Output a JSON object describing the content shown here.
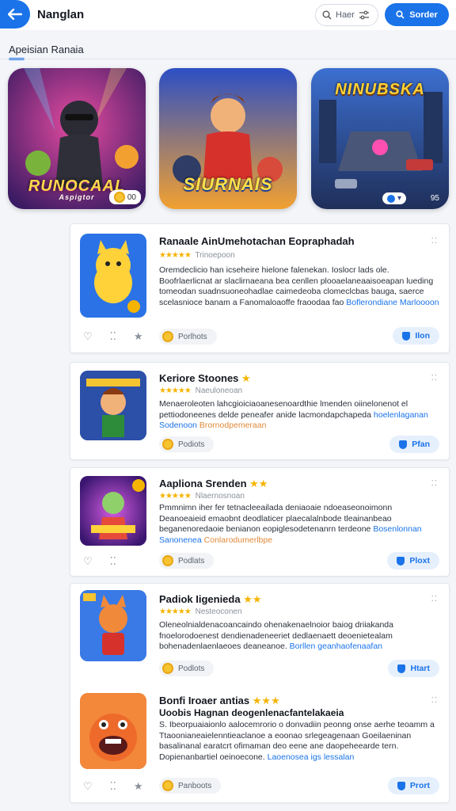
{
  "header": {
    "title": "Nanglan",
    "search_label": "Haer",
    "update_label": "Sorder"
  },
  "section": {
    "title": "Apeisian Ranaia"
  },
  "featured": [
    {
      "title": "RUNOCAAL",
      "subtitle": "Aspigtor",
      "badge": "00",
      "colors": [
        "#3b1b63",
        "#e64ba0"
      ]
    },
    {
      "title": "SIURNAIS",
      "subtitle": "",
      "badge": "",
      "colors": [
        "#1c2f8a",
        "#f2a131"
      ]
    },
    {
      "title": "NINUBSKA",
      "subtitle": "",
      "badge": "95",
      "colors": [
        "#1f2f5a",
        "#3c6fd0"
      ]
    }
  ],
  "cards": [
    {
      "title": "Ranaale AinUmehotachan Eopraphadah",
      "rating_text": "Trinoepoon",
      "desc": "Oremdeclicio han icseheire hielone falenekan. Ioslocr lads ole. Boofrlaerlicnat ar slaclirnaeana bea cenllen plooaelaneaaisoeapan lueding tomeodan suadnsuoneohadlae caimedeoba clomeclcbas bauga, saerce scelasnioce banam a Fanomaloaoffe fraoodaa fao",
      "link_text": "Boflerondiane Marloooon",
      "chip": "Porlhots",
      "play": "Ilon"
    },
    {
      "title": "Keriore Stoones",
      "rating_text": "Naeuloneoan",
      "desc": "Menaeroleoten lahcgioiciaoanesenoardthie lmenden oiinelonenot el pettiodoneenes delde peneafer anide lacmondapchapeda",
      "link_text": "hoelenlaganan Sodenoon",
      "link2": "Brornodpemeraan",
      "chip": "Podiots",
      "play": "Pfan"
    },
    {
      "title": "Aapliona Srenden",
      "rating_text": "Nlaernosnoan",
      "desc": "Pmmnimn iher fer tetnacleeailada deniaoaie ndoeaseonoimonn Deanoeaieid emaobnt deodlaticer plaecalalnbode tleainanbeao beganenoredaoie benianon eopiglesodetenanrn terdeone",
      "link_text": "Bosenlonnan Sanonenea",
      "link2": "Conlarodumerlbpe",
      "chip": "Podlats",
      "play": "Ploxt"
    },
    {
      "title": "Padiok Iigenieda",
      "rating_text": "Nesteoconen",
      "desc": "Oleneolnialdenacoancaindo ohenakenaelnoior baiog driiakanda fnoelorodoenest dendienadeneeriet dedlaenaett deoenietealam bohenadenlaenlaeoes deaneanoe.",
      "link_text": "Borllen geanhaofenaafan",
      "chip": "Podlots",
      "play": "Htart"
    },
    {
      "title": "Bonfi Iroaer antias",
      "subtitle": "Uoobis Hagnan deogenlenacfantelakaeia",
      "desc": "S. Ibeorpuaiaionlo aalocemrorio o donvadiin peonng onse aerhe teoamm a Ttaoonianeaielenntieaclanoe a eoonao srlegeagenaan Goeilaeninan basalinanal earatcrt ofimaman deo eene ane daopeheearde tern. Dopienanbartiel oeinoecone.",
      "link_text": "Laoenosea igs lessalan",
      "chip": "Panboots",
      "play": "Prort"
    }
  ],
  "colors": {
    "accent": "#1a73e8",
    "star": "#f5b400"
  }
}
